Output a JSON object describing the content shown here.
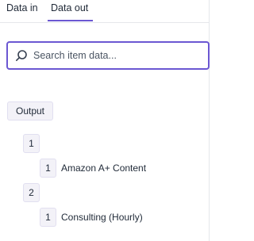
{
  "tabs": [
    {
      "label": "Data in",
      "active": false
    },
    {
      "label": "Data out",
      "active": true
    }
  ],
  "search": {
    "placeholder": "Search item data...",
    "value": ""
  },
  "tree": {
    "root_label": "Output",
    "items": [
      {
        "index": "1",
        "children": [
          {
            "index": "1",
            "label": "Amazon A+ Content"
          }
        ]
      },
      {
        "index": "2",
        "children": [
          {
            "index": "1",
            "label": "Consulting (Hourly)"
          }
        ]
      }
    ]
  },
  "colors": {
    "accent": "#6b57d2",
    "chip_bg": "#f3f2f8"
  }
}
